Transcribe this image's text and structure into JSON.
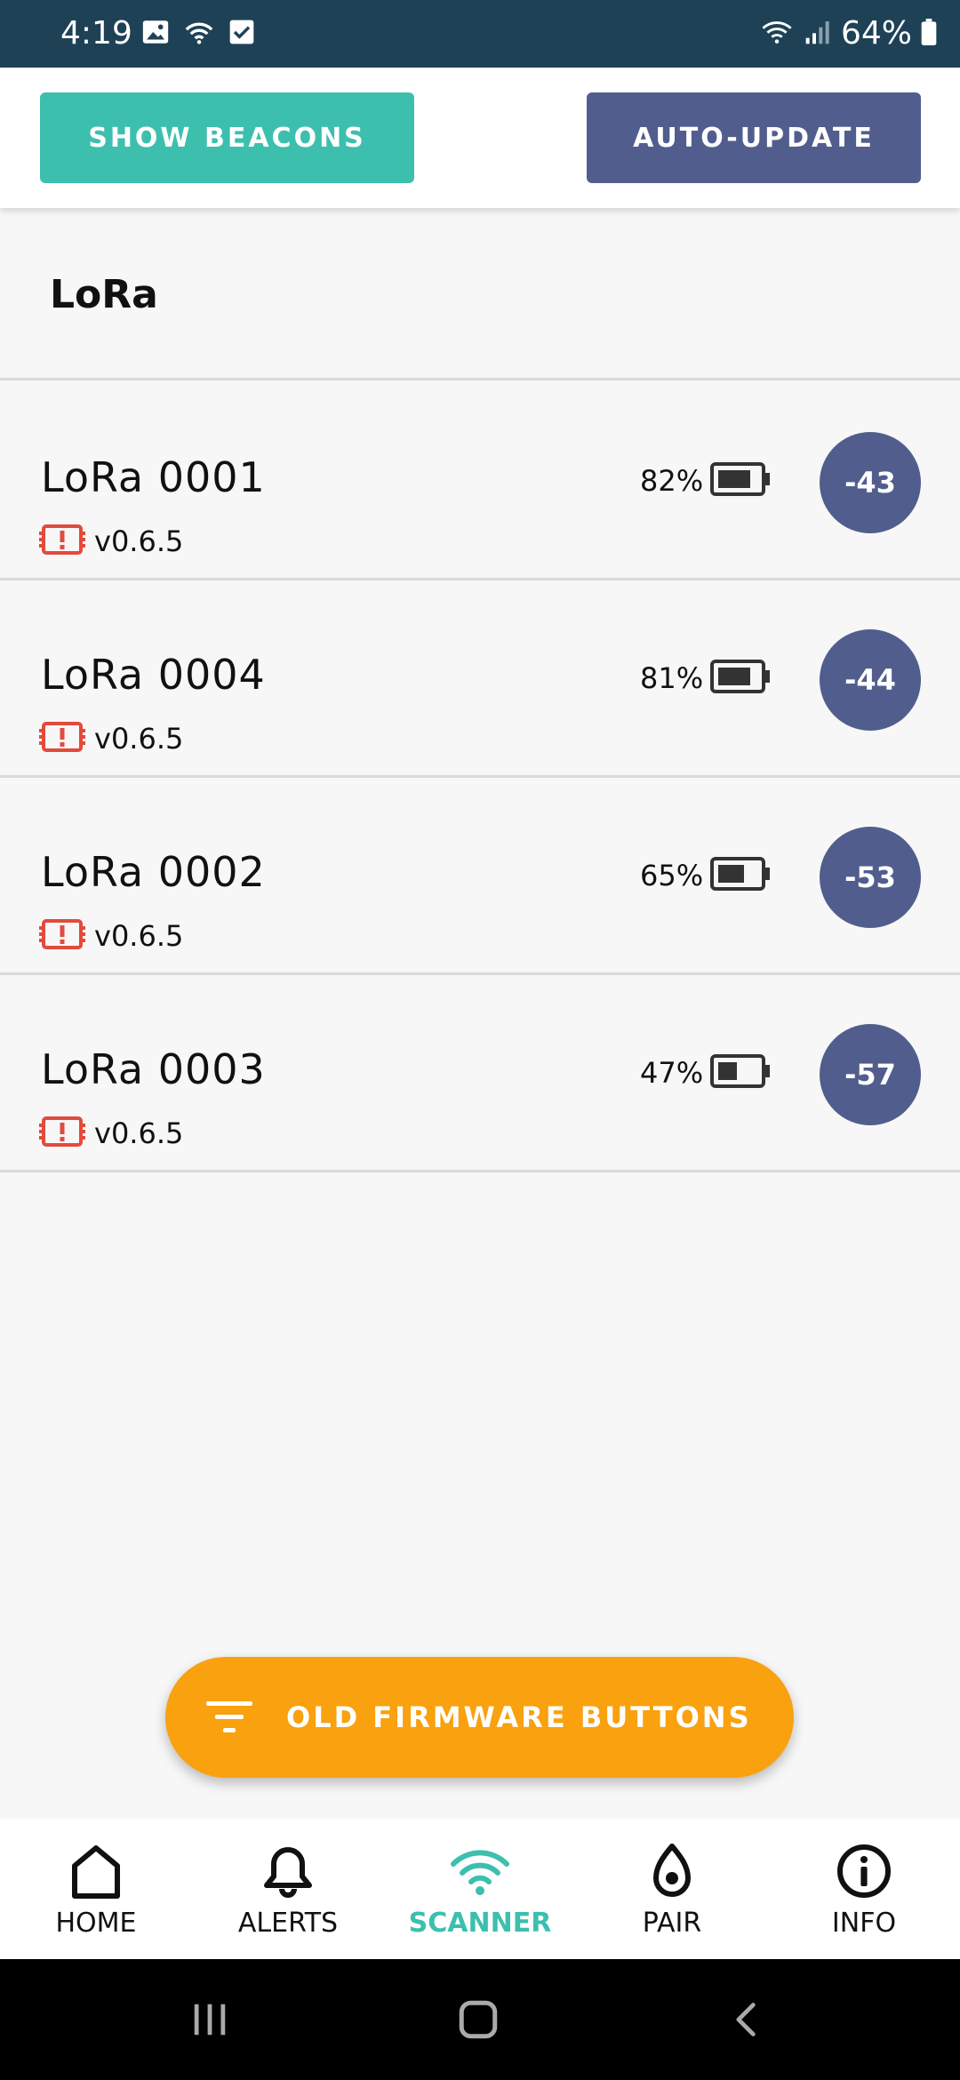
{
  "status_bar": {
    "time": "4:19",
    "battery": "64%",
    "icons": [
      "image-icon",
      "hotspot-icon",
      "checkbox-icon",
      "wifi-icon",
      "signal-icon",
      "battery-icon"
    ]
  },
  "actions": {
    "show_beacons": "SHOW BEACONS",
    "auto_update": "AUTO-UPDATE"
  },
  "section": {
    "title": "LoRa"
  },
  "devices": [
    {
      "name": "LoRa 0001",
      "firmware": "v0.6.5",
      "battery": "82%",
      "battery_level": 0.82,
      "rssi": "-43"
    },
    {
      "name": "LoRa 0004",
      "firmware": "v0.6.5",
      "battery": "81%",
      "battery_level": 0.81,
      "rssi": "-44"
    },
    {
      "name": "LoRa 0002",
      "firmware": "v0.6.5",
      "battery": "65%",
      "battery_level": 0.65,
      "rssi": "-53"
    },
    {
      "name": "LoRa 0003",
      "firmware": "v0.6.5",
      "battery": "47%",
      "battery_level": 0.47,
      "rssi": "-57"
    }
  ],
  "fab": {
    "label": "OLD FIRMWARE BUTTONS",
    "icon": "filter-icon"
  },
  "nav": {
    "items": [
      {
        "label": "HOME",
        "icon": "home-icon"
      },
      {
        "label": "ALERTS",
        "icon": "bell-icon"
      },
      {
        "label": "SCANNER",
        "icon": "wifi-icon",
        "active": true
      },
      {
        "label": "PAIR",
        "icon": "pair-icon"
      },
      {
        "label": "INFO",
        "icon": "info-icon"
      }
    ]
  },
  "colors": {
    "status_bar": "#1e4156",
    "teal": "#3dbfae",
    "indigo": "#515e8d",
    "orange": "#f9a10e",
    "firmware_warning": "#e24b3b"
  }
}
